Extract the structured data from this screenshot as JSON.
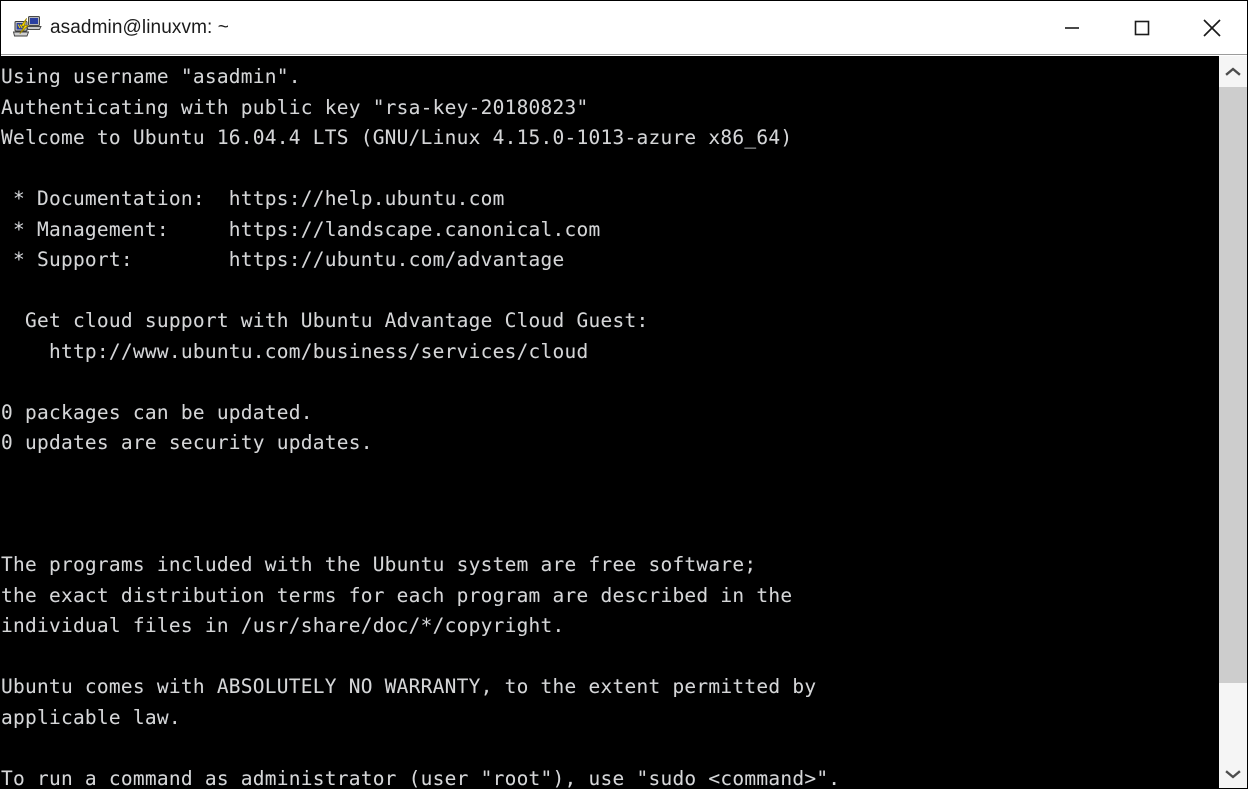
{
  "window": {
    "title": "asadmin@linuxvm: ~",
    "icon": "putty-icon",
    "background_color": "#ffffff",
    "border_color": "#000000"
  },
  "titlebar": {
    "minimize_label": "minimize-icon",
    "maximize_label": "maximize-icon",
    "close_label": "close-icon"
  },
  "terminal": {
    "background_color": "#000000",
    "text_color": "#d6d6d6",
    "lines": [
      "Using username \"asadmin\".",
      "Authenticating with public key \"rsa-key-20180823\"",
      "Welcome to Ubuntu 16.04.4 LTS (GNU/Linux 4.15.0-1013-azure x86_64)",
      "",
      " * Documentation:  https://help.ubuntu.com",
      " * Management:     https://landscape.canonical.com",
      " * Support:        https://ubuntu.com/advantage",
      "",
      "  Get cloud support with Ubuntu Advantage Cloud Guest:",
      "    http://www.ubuntu.com/business/services/cloud",
      "",
      "0 packages can be updated.",
      "0 updates are security updates.",
      "",
      "",
      "",
      "The programs included with the Ubuntu system are free software;",
      "the exact distribution terms for each program are described in the",
      "individual files in /usr/share/doc/*/copyright.",
      "",
      "Ubuntu comes with ABSOLUTELY NO WARRANTY, to the extent permitted by",
      "applicable law.",
      "",
      "To run a command as administrator (user \"root\"), use \"sudo <command>\"."
    ],
    "text": "Using username \"asadmin\".\nAuthenticating with public key \"rsa-key-20180823\"\nWelcome to Ubuntu 16.04.4 LTS (GNU/Linux 4.15.0-1013-azure x86_64)\n\n * Documentation:  https://help.ubuntu.com\n * Management:     https://landscape.canonical.com\n * Support:        https://ubuntu.com/advantage\n\n  Get cloud support with Ubuntu Advantage Cloud Guest:\n    http://www.ubuntu.com/business/services/cloud\n\n0 packages can be updated.\n0 updates are security updates.\n\n\n\nThe programs included with the Ubuntu system are free software;\nthe exact distribution terms for each program are described in the\nindividual files in /usr/share/doc/*/copyright.\n\nUbuntu comes with ABSOLUTELY NO WARRANTY, to the extent permitted by\napplicable law.\n\nTo run a command as administrator (user \"root\"), use \"sudo <command>\"."
  },
  "scrollbar": {
    "up_arrow": "chevron-up-icon",
    "down_arrow": "chevron-down-icon",
    "thumb_color": "#cdcdcd",
    "track_color": "#f5f5f5"
  }
}
